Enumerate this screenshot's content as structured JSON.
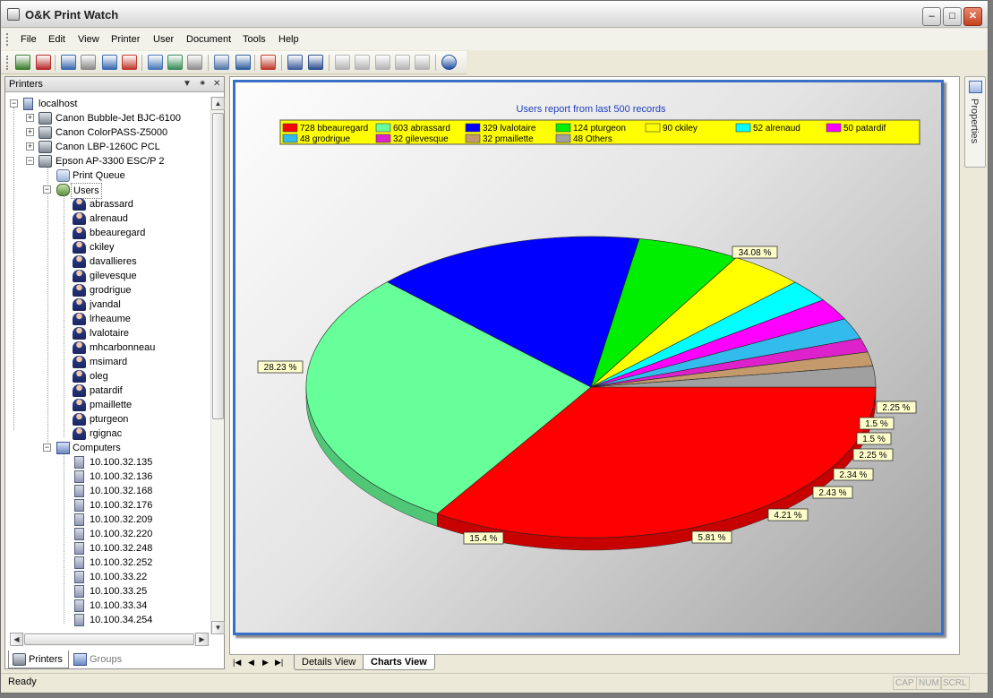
{
  "window": {
    "title": "O&K Print Watch"
  },
  "menu": [
    "File",
    "Edit",
    "View",
    "Printer",
    "User",
    "Document",
    "Tools",
    "Help"
  ],
  "toolbar_icons": [
    "add-printer-icon",
    "delete-printer-icon",
    "printer-refresh-icon",
    "printer-pause-icon",
    "printer-resume-icon",
    "printer-stop-icon",
    "queue-icon",
    "queue-refresh-icon",
    "queue-settings-icon",
    "permissions-icon",
    "key-icon",
    "delete-job-icon",
    "print-preview-icon",
    "search-icon",
    "copy-icon",
    "move-icon",
    "export-icon",
    "document-delete-icon",
    "document-edit-icon",
    "about-icon"
  ],
  "left_panel": {
    "title": "Printers",
    "tree": {
      "host": "localhost",
      "printers": [
        "Canon Bubble-Jet BJC-6100",
        "Canon ColorPASS-Z5000",
        "Canon LBP-1260C PCL",
        "Epson AP-3300 ESC/P 2"
      ],
      "print_queue": "Print Queue",
      "users_label": "Users",
      "users": [
        "abrassard",
        "alrenaud",
        "bbeauregard",
        "ckiley",
        "davallieres",
        "gilevesque",
        "grodrigue",
        "jvandal",
        "lrheaume",
        "lvalotaire",
        "mhcarbonneau",
        "msimard",
        "oleg",
        "patardif",
        "pmaillette",
        "pturgeon",
        "rgignac"
      ],
      "computers_label": "Computers",
      "computers": [
        "10.100.32.135",
        "10.100.32.136",
        "10.100.32.168",
        "10.100.32.176",
        "10.100.32.209",
        "10.100.32.220",
        "10.100.32.248",
        "10.100.32.252",
        "10.100.33.22",
        "10.100.33.25",
        "10.100.33.34",
        "10.100.34.254"
      ]
    },
    "tabs": [
      "Printers",
      "Groups"
    ]
  },
  "chart_data": {
    "type": "pie",
    "title": "Users report from last 500 records",
    "legend_placement": "top",
    "slices": [
      {
        "legend": "728 bbeauregard",
        "value": 728,
        "percent_label": "34.08 %",
        "color": "#ff0000"
      },
      {
        "legend": "603 abrassard",
        "value": 603,
        "percent_label": "28.23 %",
        "color": "#66ff99"
      },
      {
        "legend": "329 lvalotaire",
        "value": 329,
        "percent_label": "15.4 %",
        "color": "#0000ff"
      },
      {
        "legend": "124 pturgeon",
        "value": 124,
        "percent_label": "5.81 %",
        "color": "#00ee00"
      },
      {
        "legend": "90 ckiley",
        "value": 90,
        "percent_label": "4.21 %",
        "color": "#ffff00"
      },
      {
        "legend": "52 alrenaud",
        "value": 52,
        "percent_label": "2.43 %",
        "color": "#00ffff"
      },
      {
        "legend": "50 patardif",
        "value": 50,
        "percent_label": "2.34 %",
        "color": "#ff00ff"
      },
      {
        "legend": "48 grodrigue",
        "value": 48,
        "percent_label": "2.25 %",
        "color": "#33bbee"
      },
      {
        "legend": "32 gilevesque",
        "value": 32,
        "percent_label": "1.5 %",
        "color": "#dd22cc"
      },
      {
        "legend": "32 pmaillette",
        "value": 32,
        "percent_label": "1.5 %",
        "color": "#c49a6c"
      },
      {
        "legend": "48 Others",
        "value": 48,
        "percent_label": "2.25 %",
        "color": "#a0a0a0"
      }
    ]
  },
  "doc_tabs": [
    "Details View",
    "Charts View"
  ],
  "properties_label": "Properties",
  "status": {
    "text": "Ready",
    "indicators": [
      "CAP",
      "NUM",
      "SCRL"
    ]
  }
}
